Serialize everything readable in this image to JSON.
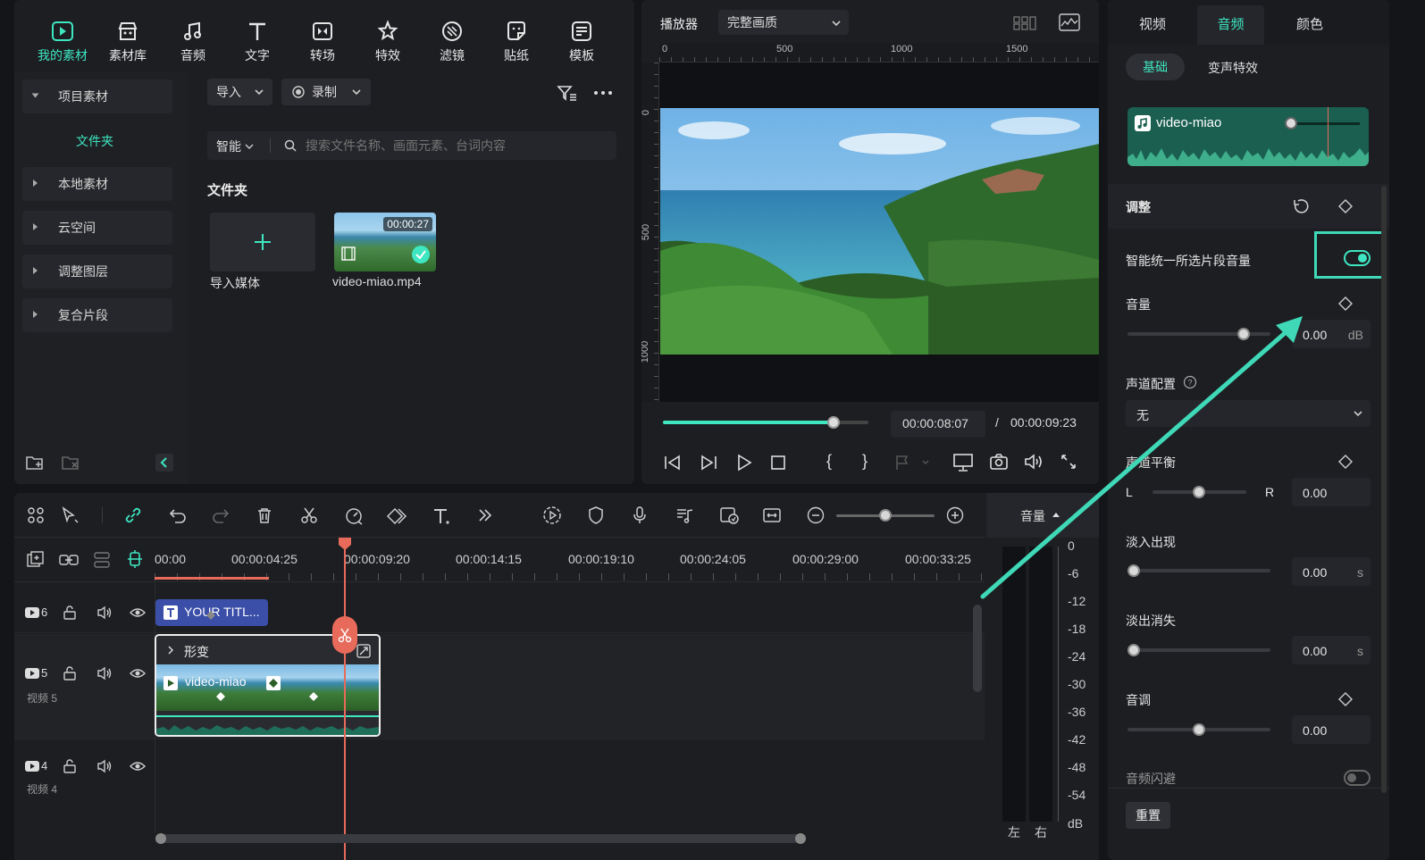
{
  "media_toolbar": {
    "tools": [
      {
        "label": "我的素材",
        "icon": "my-media-icon",
        "active": true
      },
      {
        "label": "素材库",
        "icon": "library-icon"
      },
      {
        "label": "音频",
        "icon": "music-icon"
      },
      {
        "label": "文字",
        "icon": "text-icon"
      },
      {
        "label": "转场",
        "icon": "transition-icon"
      },
      {
        "label": "特效",
        "icon": "effects-icon"
      },
      {
        "label": "滤镜",
        "icon": "filter-icon"
      },
      {
        "label": "贴纸",
        "icon": "sticker-icon"
      },
      {
        "label": "模板",
        "icon": "template-icon"
      }
    ]
  },
  "media_sidebar": {
    "project_media": "项目素材",
    "folder": "文件夹",
    "items": [
      "本地素材",
      "云空间",
      "调整图层",
      "复合片段"
    ]
  },
  "media_panel": {
    "import_label": "导入",
    "record_label": "录制",
    "smart_label": "智能",
    "search_placeholder": "搜索文件名称、画面元素、台词内容",
    "folder_title": "文件夹",
    "import_media_label": "导入媒体",
    "clip_name": "video-miao.mp4",
    "clip_duration": "00:00:27"
  },
  "player": {
    "title": "播放器",
    "quality": "完整画质",
    "ruler_top": [
      "0",
      "500",
      "1000",
      "1500"
    ],
    "ruler_left": [
      "0",
      "500",
      "1000"
    ],
    "current_time": "00:00:08:07",
    "separator": "/",
    "total_time": "00:00:09:23",
    "progress": 0.83,
    "brace_open": "{",
    "brace_close": "}"
  },
  "right_panel": {
    "tabs": [
      "视频",
      "音频",
      "颜色"
    ],
    "active_tab": "音频",
    "subtabs": [
      "基础",
      "变声特效"
    ],
    "clip_name": "video-miao",
    "adjust_title": "调整",
    "normalize_label": "智能统一所选片段音量",
    "volume_label": "音量",
    "volume_value": "0.00",
    "volume_unit": "dB",
    "channel_label": "声道配置",
    "channel_value": "无",
    "balance_label": "声道平衡",
    "balance_l": "L",
    "balance_r": "R",
    "balance_value": "0.00",
    "fade_in_label": "淡入出现",
    "fade_in_value": "0.00",
    "fade_in_unit": "s",
    "fade_out_label": "淡出消失",
    "fade_out_value": "0.00",
    "fade_out_unit": "s",
    "pitch_label": "音调",
    "pitch_value": "0.00",
    "ducking_label": "音频闪避",
    "reset_label": "重置",
    "colors": {
      "accent": "#3ee6c1",
      "annotation": "#3fd9b8"
    }
  },
  "timeline": {
    "timecodes": [
      "00:00",
      "00:00:04:25",
      "00:00:09:20",
      "00:00:14:15",
      "00:00:19:10",
      "00:00:24:05",
      "00:00:29:00",
      "00:00:33:25"
    ],
    "title_clip": "YOUR TITL...",
    "clip_group_label": "形变",
    "video_clip": "video-miao",
    "tracks": [
      {
        "num": "6",
        "name": ""
      },
      {
        "num": "5",
        "name": "视频 5"
      },
      {
        "num": "4",
        "name": "视频 4"
      }
    ]
  },
  "audio_meter": {
    "title": "音量",
    "scale": [
      "0",
      "-6",
      "-12",
      "-18",
      "-24",
      "-30",
      "-36",
      "-42",
      "-48",
      "-54",
      "dB"
    ],
    "left": "左",
    "right": "右"
  }
}
